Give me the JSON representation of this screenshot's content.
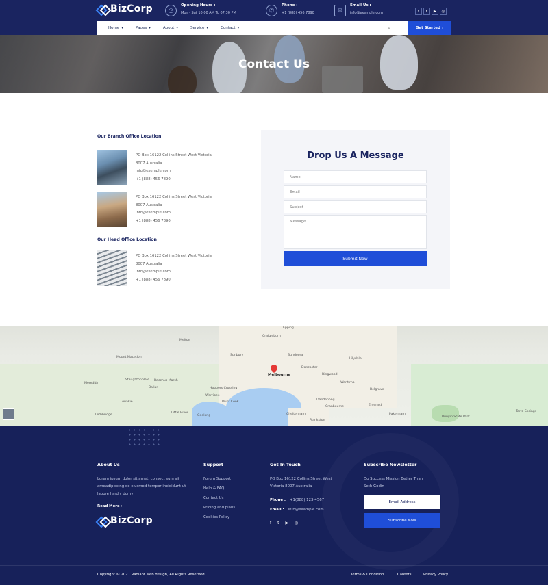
{
  "brand": {
    "name": "BizCorp"
  },
  "topbar": {
    "opening": {
      "title": "Opening Hours :",
      "value": "Mon - Sat 10:00 AM To 07:30 PM"
    },
    "phone": {
      "title": "Phone :",
      "value": "+1 (888) 456 7890"
    },
    "email": {
      "title": "Email Us :",
      "value": "info@exemple.com"
    },
    "socials": [
      "f",
      "t",
      "yt",
      "ig"
    ]
  },
  "nav": {
    "items": [
      "Home",
      "Pages",
      "About",
      "Service",
      "Contact"
    ],
    "cta": "Get Started"
  },
  "hero": {
    "title": "Contact Us"
  },
  "branch": {
    "title": "Our Branch Office Location",
    "locations": [
      {
        "line1": "PO Box 16122 Collins Street West Victoria",
        "line2": "8007 Australia",
        "email": "info@exemple.com",
        "phone": "+1 (888) 456 7890"
      },
      {
        "line1": "PO Box 16122 Collins Street West Victoria",
        "line2": "8007 Australia",
        "email": "info@exemple.com",
        "phone": "+1 (888) 456 7890"
      }
    ]
  },
  "head": {
    "title": "Our Head Office Location",
    "location": {
      "line1": "PO Box 16122 Collins Street West Victoria",
      "line2": "8007 Australia",
      "email": "info@exemple.com",
      "phone": "+1 (888) 456 7890"
    }
  },
  "form": {
    "title": "Drop Us A Message",
    "name_placeholder": "Name",
    "email_placeholder": "Email",
    "subject_placeholder": "Subject",
    "message_placeholder": "Message",
    "submit": "Submit Now"
  },
  "map": {
    "labels": [
      "Melbourne",
      "Werribee",
      "Geelong",
      "Point Cook",
      "Dandenong",
      "Frankston",
      "Cheltenham",
      "Mount Macedon",
      "Sunbury",
      "Craigieburn",
      "Epping",
      "Bundoora",
      "Doncaster",
      "Ringwood",
      "Lilydale",
      "Belgrave",
      "Cranbourne",
      "Bunyip State Park",
      "Tarra Springs",
      "Melton",
      "Bacchus Marsh",
      "Ballan",
      "Meredith",
      "Lethbridge",
      "Staughton Vale",
      "Anakie",
      "Little River",
      "Hoppers Crossing",
      "Wantirna",
      "Emerald",
      "Pakenham"
    ]
  },
  "footer": {
    "about": {
      "title": "About Us",
      "text": "Lorem ipsum dolor sit amet, consect sum sit ameadipiscing do eiusmod tempor incididunt ut labore hardly domy",
      "more": "Read More"
    },
    "support": {
      "title": "Support",
      "links": [
        "Forum Support",
        "Help & FAQ",
        "Contact Us",
        "Pricing and plans",
        "Cookies Policy"
      ]
    },
    "touch": {
      "title": "Get In Touch",
      "address": "PO Box 16122 Collins Street West Victoria 8007 Australia",
      "phone_label": "Phone :",
      "phone": "+1(888) 123-4567",
      "email_label": "Email :",
      "email": "info@example.com"
    },
    "newsletter": {
      "title": "Subscribe Newsletter",
      "text": "Do Success Mission Better Than Seth Godin",
      "email_placeholder": "Email Address",
      "button": "Subscribe Now"
    },
    "copyright": "Copyright © 2021 Radiant web design, All Rights Reserved.",
    "bottom_links": [
      "Terms & Condition",
      "Careers",
      "Privacy Policy"
    ]
  }
}
